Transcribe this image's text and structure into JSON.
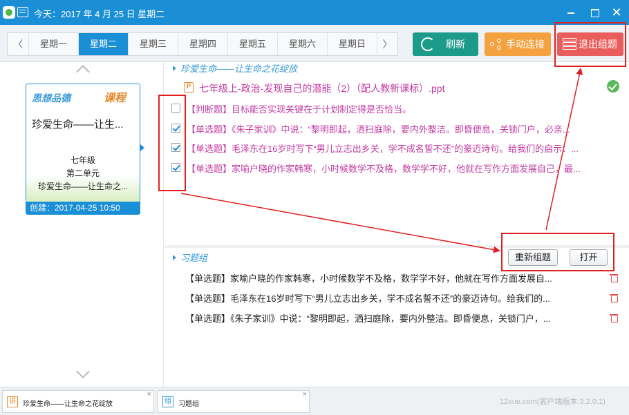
{
  "title_bar": {
    "today": "今天：2017 年 4 月 25 日 星期二"
  },
  "toolbar": {
    "prev_label": "〈",
    "next_label": "〉",
    "days": [
      "星期一",
      "星期二",
      "星期三",
      "星期四",
      "星期五",
      "星期六",
      "星期日"
    ],
    "active_day": "星期二",
    "refresh_label": "刷新",
    "connect_label": "手动连接",
    "exit_group_label": "退出组题"
  },
  "lesson_card": {
    "subject": "思想品德",
    "tag": "课程",
    "title": "珍爱生命——让生...",
    "grade": "七年级",
    "unit": "第二单元",
    "lesson": "珍爱生命——让生命之...",
    "created": "创建：2017-04-25 10:50"
  },
  "lesson_section": {
    "heading": "珍爱生命——让生命之花绽放",
    "file_name": "七年级上-政治-发现自己的潜能（2）（配人教新课标）.ppt",
    "questions": [
      {
        "text": "【判断题】目标能否实现关键在于计划制定得是否恰当。",
        "checked": false
      },
      {
        "text": "【单选题】《朱子家训》中说：“黎明即起，洒扫庭除，要内外整洁。即昏便息，关锁门户，必亲...",
        "checked": true
      },
      {
        "text": "【单选题】毛泽东在16岁时写下“男儿立志出乡关，学不成名誓不还”的豪迈诗句。给我们的启示：...",
        "checked": true
      },
      {
        "text": "【单选题】家喻户晓的作家韩寒，小时候数学不及格，数学学不好，他就在写作方面发展自己，最...",
        "checked": true
      }
    ]
  },
  "group_section": {
    "heading": "习题组",
    "regroup_label": "重新组题",
    "open_label": "打开",
    "items": [
      "【单选题】家喻户晓的作家韩寒，小时候数学不及格，数学学不好，他就在写作方面发展自...",
      "【单选题】毛泽东在16岁时写下“男儿立志出乡关，学不成名誓不还”的豪迈诗句。给我们的...",
      "【单选题】《朱子家训》中说：“黎明即起，洒扫庭除，要内外整洁。即昏便息，关锁门户，..."
    ]
  },
  "bottom_bar": {
    "tabs": [
      {
        "icon": "讲",
        "label": "珍爱生命——让生命之花绽放",
        "close": "×"
      },
      {
        "icon": "组",
        "label": "习题组",
        "close": "×"
      }
    ],
    "version": "12xue.com(客户端版本:3.2.0.1)"
  },
  "colors": {
    "primary": "#1a8fd6",
    "refresh": "#1c9a8a",
    "connect": "#f4a13f",
    "exit": "#ea5d5d",
    "question_text": "#c23aa3",
    "annotation": "#e02020"
  }
}
